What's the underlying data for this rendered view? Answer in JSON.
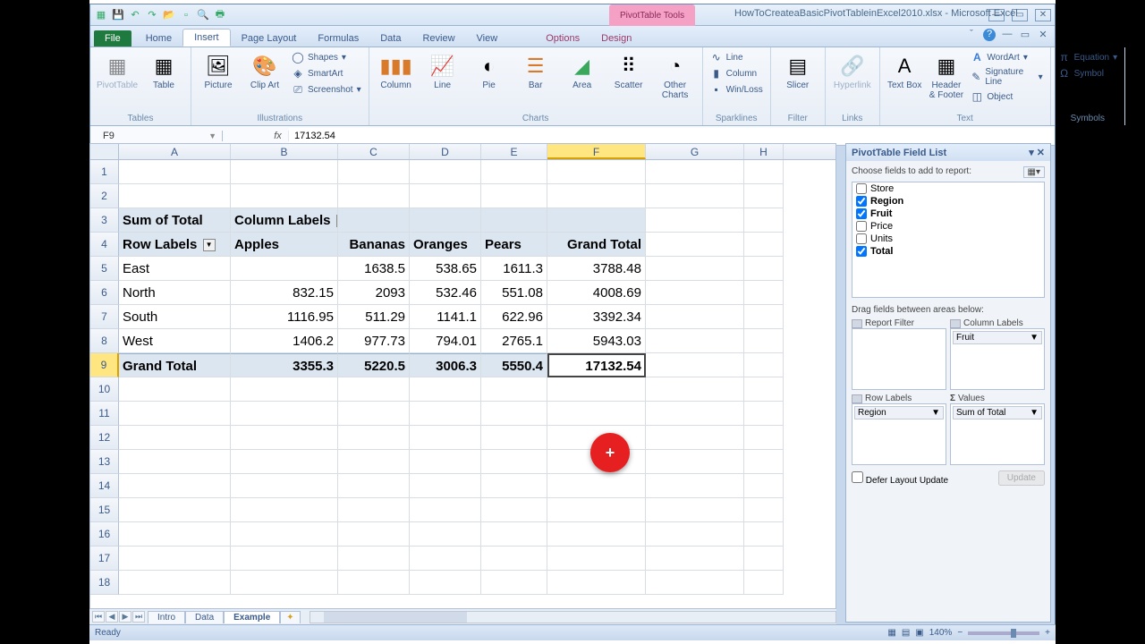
{
  "app": {
    "title": "HowToCreateaBasicPivotTableinExcel2010.xlsx - Microsoft Excel",
    "contextual_tab_group": "PivotTable Tools"
  },
  "tabs": {
    "file": "File",
    "items": [
      "Home",
      "Insert",
      "Page Layout",
      "Formulas",
      "Data",
      "Review",
      "View"
    ],
    "active": "Insert",
    "context_items": [
      "Options",
      "Design"
    ]
  },
  "ribbon": {
    "groups": {
      "tables": {
        "label": "Tables",
        "items": [
          "PivotTable",
          "Table"
        ]
      },
      "illustrations": {
        "label": "Illustrations",
        "items": [
          "Picture",
          "Clip Art"
        ],
        "small": [
          "Shapes",
          "SmartArt",
          "Screenshot"
        ]
      },
      "charts": {
        "label": "Charts",
        "items": [
          "Column",
          "Line",
          "Pie",
          "Bar",
          "Area",
          "Scatter",
          "Other Charts"
        ]
      },
      "sparklines": {
        "label": "Sparklines",
        "items": [
          "Line",
          "Column",
          "Win/Loss"
        ]
      },
      "filter": {
        "label": "Filter",
        "items": [
          "Slicer"
        ]
      },
      "links": {
        "label": "Links",
        "items": [
          "Hyperlink"
        ]
      },
      "text": {
        "label": "Text",
        "items": [
          "Text Box",
          "Header & Footer"
        ],
        "small": [
          "WordArt",
          "Signature Line",
          "Object"
        ]
      },
      "symbols": {
        "label": "Symbols",
        "items": [
          "Equation",
          "Symbol"
        ]
      }
    }
  },
  "formula_bar": {
    "name_box": "F9",
    "formula": "17132.54"
  },
  "columns": [
    "A",
    "B",
    "C",
    "D",
    "E",
    "F",
    "G",
    "H"
  ],
  "selected_col": "F",
  "selected_row": 9,
  "pivot": {
    "title_left": "Sum of Total",
    "title_right": "Column Labels",
    "row_labels_header": "Row Labels",
    "col_headers": [
      "Apples",
      "Bananas",
      "Oranges",
      "Pears",
      "Grand Total"
    ],
    "rows": [
      {
        "label": "East",
        "vals": [
          "",
          "1638.5",
          "538.65",
          "1611.3",
          "3788.48"
        ]
      },
      {
        "label": "North",
        "vals": [
          "832.15",
          "2093",
          "532.46",
          "551.08",
          "4008.69"
        ]
      },
      {
        "label": "South",
        "vals": [
          "1116.95",
          "511.29",
          "1141.1",
          "622.96",
          "3392.34"
        ]
      },
      {
        "label": "West",
        "vals": [
          "1406.2",
          "977.73",
          "794.01",
          "2765.1",
          "5943.03"
        ]
      }
    ],
    "grand_total_label": "Grand Total",
    "grand_totals": [
      "3355.3",
      "5220.5",
      "3006.3",
      "5550.4",
      "17132.54"
    ]
  },
  "sheets": {
    "tabs": [
      "Intro",
      "Data",
      "Example"
    ],
    "active": "Example"
  },
  "status": {
    "mode": "Ready",
    "zoom": "140%"
  },
  "fieldlist": {
    "title": "PivotTable Field List",
    "prompt": "Choose fields to add to report:",
    "fields": [
      {
        "name": "Store",
        "checked": false
      },
      {
        "name": "Region",
        "checked": true,
        "bold": true
      },
      {
        "name": "Fruit",
        "checked": true,
        "bold": true
      },
      {
        "name": "Price",
        "checked": false
      },
      {
        "name": "Units",
        "checked": false
      },
      {
        "name": "Total",
        "checked": true,
        "bold": true
      }
    ],
    "drag_prompt": "Drag fields between areas below:",
    "areas": {
      "report_filter": {
        "label": "Report Filter",
        "items": []
      },
      "column_labels": {
        "label": "Column Labels",
        "items": [
          "Fruit"
        ]
      },
      "row_labels": {
        "label": "Row Labels",
        "items": [
          "Region"
        ]
      },
      "values": {
        "label": "Values",
        "items": [
          "Sum of Total"
        ]
      }
    },
    "defer": "Defer Layout Update",
    "update": "Update"
  }
}
